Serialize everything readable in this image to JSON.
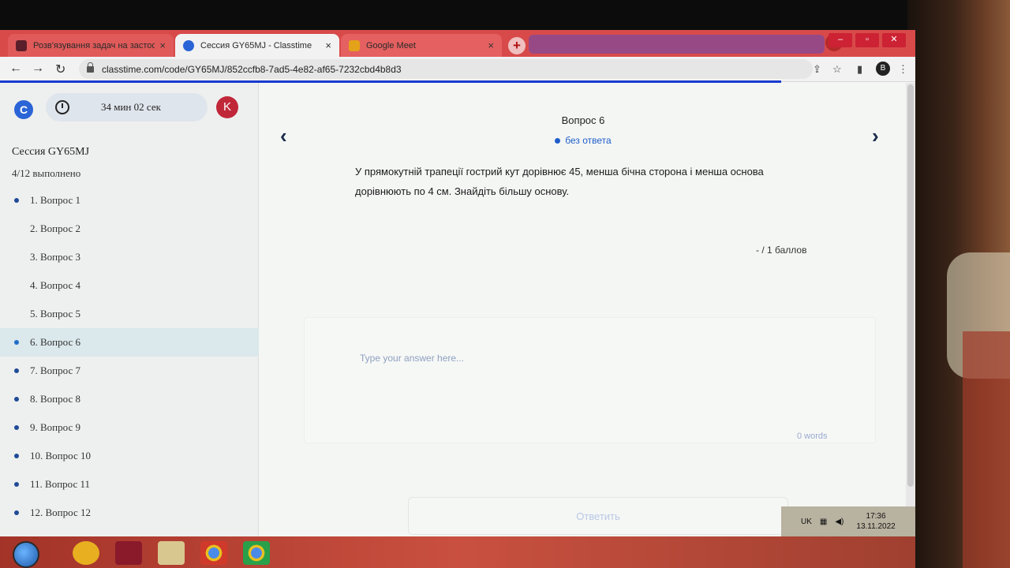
{
  "browser": {
    "tabs": [
      {
        "label": "Розв'язування задач на застосув",
        "favicon_color": "#5a1f2a"
      },
      {
        "label": "Сессия GY65MJ - Classtime",
        "favicon_color": "#2a64d6"
      },
      {
        "label": "Google Meet",
        "favicon_color": "#e3a21a"
      }
    ],
    "close_symbol": "×",
    "new_tab_symbol": "+",
    "url": "classtime.com/code/GY65MJ/852ccfb8-7ad5-4e82-af65-7232cbd4b8d3",
    "profile_letter": "B"
  },
  "sidebar": {
    "logo_letter": "C",
    "timer": "34 мин 02 сек",
    "user_initial": "K",
    "session_title": "Сессия GY65MJ",
    "progress": "4/12 выполнено",
    "questions": [
      {
        "label": "1. Вопрос 1",
        "state": "answered"
      },
      {
        "label": "2. Вопрос 2",
        "state": "none"
      },
      {
        "label": "3. Вопрос 3",
        "state": "none"
      },
      {
        "label": "4. Вопрос 4",
        "state": "none"
      },
      {
        "label": "5. Вопрос 5",
        "state": "none"
      },
      {
        "label": "6. Вопрос 6",
        "state": "active"
      },
      {
        "label": "7. Вопрос 7",
        "state": "answered"
      },
      {
        "label": "8. Вопрос 8",
        "state": "answered"
      },
      {
        "label": "9. Вопрос 9",
        "state": "answered"
      },
      {
        "label": "10. Вопрос 10",
        "state": "answered"
      },
      {
        "label": "11. Вопрос 11",
        "state": "answered"
      },
      {
        "label": "12. Вопрос 12",
        "state": "answered"
      }
    ]
  },
  "main": {
    "heading": "Вопрос 6",
    "status": "без ответа",
    "question_text": "У прямокутній трапеції гострий кут дорівнює 45, менша бічна сторона і менша основа дорівнюють по 4 см. Знайдіть більшу основу.",
    "score": "- / 1 баллов",
    "answer_placeholder": "Type your answer here...",
    "word_count": "0 words",
    "submit_label": "Ответить",
    "prev_arrow": "‹",
    "next_arrow": "›"
  },
  "system": {
    "language": "UK",
    "time": "17:36",
    "date": "13.11.2022"
  },
  "colors": {
    "accent": "#1f5ec9",
    "tab_strip": "#d84a4a",
    "user_badge": "#c0283a"
  }
}
